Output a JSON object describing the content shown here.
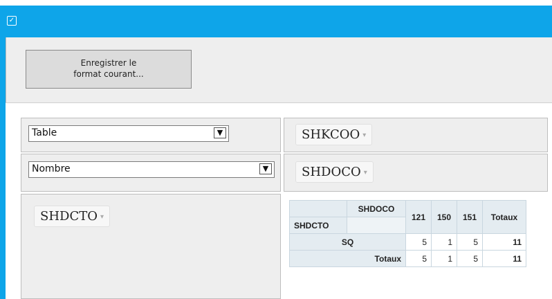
{
  "window": {
    "icon": "checkbox-app-icon"
  },
  "toolbar": {
    "save_label": "Enregistrer le\nformat courant..."
  },
  "renderer_select": {
    "value": "Table"
  },
  "aggregator_select": {
    "value": "Nombre"
  },
  "fields": {
    "col_field_1": "SHKCOO",
    "col_field_2": "SHDOCO",
    "row_field": "SHDCTO",
    "caret": "▾"
  },
  "pivot": {
    "col_attr": "SHDOCO",
    "row_attr": "SHDCTO",
    "col_keys": [
      "121",
      "150",
      "151"
    ],
    "totals_label": "Totaux",
    "rows": [
      {
        "key": "SQ",
        "values": [
          "5",
          "1",
          "5"
        ],
        "total": "11"
      }
    ],
    "col_totals": [
      "5",
      "1",
      "5"
    ],
    "grand_total": "11"
  }
}
